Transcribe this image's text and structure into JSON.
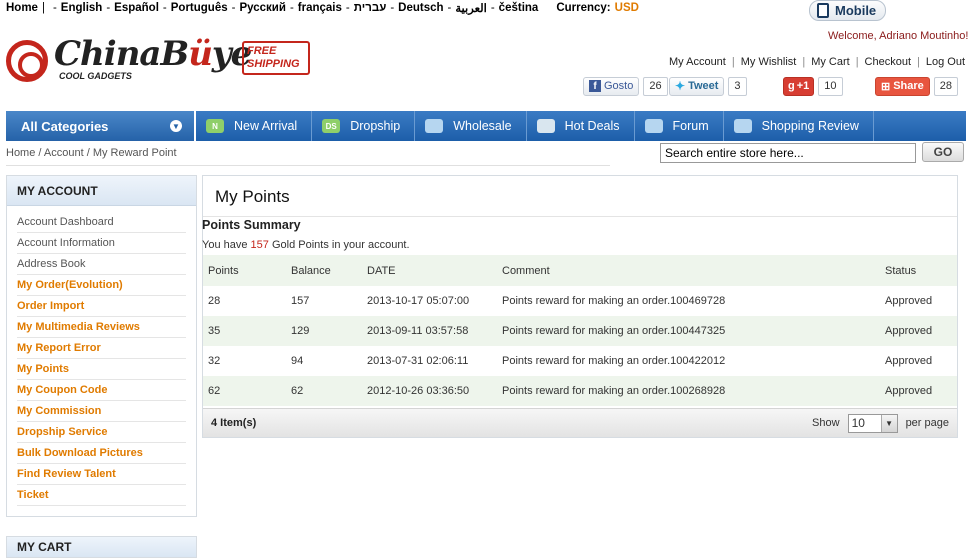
{
  "langbar": {
    "home": "Home",
    "languages": [
      "English",
      "Español",
      "Português",
      "Русский",
      "français",
      "עברית",
      "Deutsch",
      "العربية",
      "čeština"
    ],
    "currency_label": "Currency:",
    "currency_value": "USD"
  },
  "mobile_label": "Mobile",
  "welcome": "Welcome, Adriano Moutinho!",
  "toplinks": [
    "My Account",
    "My Wishlist",
    "My Cart",
    "Checkout",
    "Log Out"
  ],
  "logo": {
    "brand_a": "ChinaB",
    "brand_u": "ü",
    "brand_b": "ye",
    "tagline": "COOL GADGETS",
    "free": "FREE",
    "shipping": "SHIPPING"
  },
  "social": {
    "facebook_label": "Gosto",
    "facebook_count": "26",
    "tweet_label": "Tweet",
    "tweet_count": "3",
    "gplus_label": "+1",
    "gplus_count": "10",
    "share_label": "Share",
    "share_count": "28"
  },
  "nav": {
    "all_categories": "All Categories",
    "items": [
      "New Arrival",
      "Dropship",
      "Wholesale",
      "Hot Deals",
      "Forum",
      "Shopping Review"
    ]
  },
  "breadcrumb": "Home / Account / My Reward Point",
  "search": {
    "value": "Search entire store here...",
    "go": "GO"
  },
  "sidebar": {
    "title": "MY ACCOUNT",
    "items": [
      {
        "label": "Account Dashboard",
        "style": "grey"
      },
      {
        "label": "Account Information",
        "style": "grey"
      },
      {
        "label": "Address Book",
        "style": "grey"
      },
      {
        "label": "My Order(Evolution)",
        "style": "or"
      },
      {
        "label": "Order Import",
        "style": "or"
      },
      {
        "label": "My Multimedia Reviews",
        "style": "or"
      },
      {
        "label": "My Report Error",
        "style": "or"
      },
      {
        "label": "My Points",
        "style": "or"
      },
      {
        "label": "My Coupon Code",
        "style": "or"
      },
      {
        "label": "My Commission",
        "style": "or"
      },
      {
        "label": "Dropship Service",
        "style": "or"
      },
      {
        "label": "Bulk Download Pictures",
        "style": "or"
      },
      {
        "label": "Find Review Talent",
        "style": "or"
      },
      {
        "label": "Ticket",
        "style": "or"
      }
    ],
    "cart_title": "MY CART"
  },
  "main": {
    "title": "My Points",
    "summary_title": "Points Summary",
    "you_have_pre": "You have",
    "gold_points": "157",
    "you_have_post": "Gold Points in your account.",
    "columns": [
      "Points",
      "Balance",
      "DATE",
      "Comment",
      "Status"
    ],
    "rows": [
      [
        "28",
        "157",
        "2013-10-17 05:07:00",
        "Points reward for making an order.100469728",
        "Approved"
      ],
      [
        "35",
        "129",
        "2013-09-11 03:57:58",
        "Points reward for making an order.100447325",
        "Approved"
      ],
      [
        "32",
        "94",
        "2013-07-31 02:06:11",
        "Points reward for making an order.100422012",
        "Approved"
      ],
      [
        "62",
        "62",
        "2012-10-26 03:36:50",
        "Points reward for making an order.100268928",
        "Approved"
      ]
    ],
    "items_count": "4 Item(s)",
    "show_label": "Show",
    "per_page_value": "10",
    "per_page_label": "per page"
  }
}
